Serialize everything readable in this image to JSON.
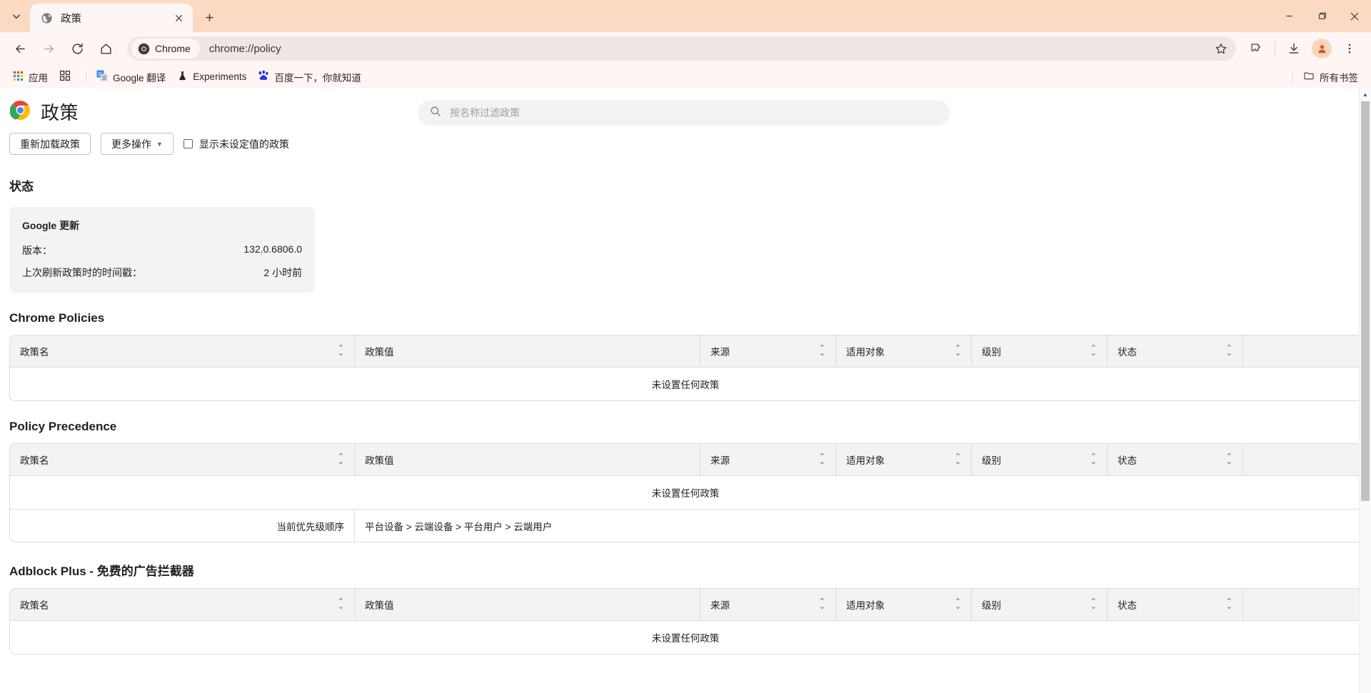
{
  "window": {
    "minimize_label": "minimize",
    "maximize_label": "maximize",
    "close_label": "close"
  },
  "tabstrip": {
    "tab_search_icon": "chevron-down-icon",
    "new_tab_label": "+",
    "tabs": [
      {
        "title": "政策",
        "favicon": "globe-icon",
        "close_label": "×",
        "active": true
      }
    ]
  },
  "toolbar": {
    "back_label": "←",
    "forward_label": "→",
    "reload_label": "⟳",
    "home_label": "⌂",
    "chrome_chip_label": "Chrome",
    "url": "chrome://policy",
    "bookmark_star": "star-icon",
    "extensions_label": "extensions-icon",
    "downloads_label": "downloads-icon",
    "profile_label": "profile-avatar",
    "menu_label": "⋮"
  },
  "bookmarks": {
    "items": [
      {
        "label": "应用",
        "icon": "apps-grid-icon"
      },
      {
        "label": "",
        "icon": "apps-panel-icon"
      },
      {
        "label": "Google 翻译",
        "icon": "google-translate-icon"
      },
      {
        "label": "Experiments",
        "icon": "flask-icon"
      },
      {
        "label": "百度一下，你就知道",
        "icon": "baidu-icon"
      }
    ],
    "all_bookmarks_label": "所有书签",
    "all_bookmarks_icon": "folder-icon"
  },
  "page": {
    "title": "政策",
    "logo": "chrome-logo-icon",
    "search": {
      "placeholder": "按名称过滤政策",
      "value": "",
      "icon": "search-icon"
    },
    "reload_policies_label": "重新加载政策",
    "more_actions_label": "更多操作",
    "more_actions_caret": "▾",
    "show_unset_label": "显示未设定值的政策",
    "show_unset_checked": false,
    "status": {
      "heading": "状态",
      "card_title": "Google 更新",
      "rows": [
        {
          "label": "版本：",
          "value": "132.0.6806.0"
        },
        {
          "label": "上次刷新政策时的时间戳：",
          "value": "2 小时前"
        }
      ]
    },
    "table_headers": {
      "name": "政策名",
      "value": "政策值",
      "source": "来源",
      "applies_to": "适用对象",
      "level": "级别",
      "status": "状态"
    },
    "empty_text": "未设置任何政策",
    "sections": [
      {
        "heading": "Chrome Policies",
        "empty_text": "未设置任何政策",
        "precedence": null
      },
      {
        "heading": "Policy Precedence",
        "empty_text": "未设置任何政策",
        "precedence": {
          "label": "当前优先级顺序",
          "value": "平台设备 > 云端设备 > 平台用户 > 云端用户"
        }
      },
      {
        "heading": "Adblock Plus - 免费的广告拦截器",
        "empty_text": "未设置任何政策",
        "precedence": null
      }
    ]
  },
  "colors": {
    "tabstrip_bg": "#fbd9c3",
    "toolbar_bg": "#fdf6f4",
    "omnibox_bg": "#f0e6e3",
    "page_bg": "#ffffff",
    "table_header_bg": "#f1f3f4",
    "table_border": "#dadce0",
    "accent_text": "#202124"
  }
}
